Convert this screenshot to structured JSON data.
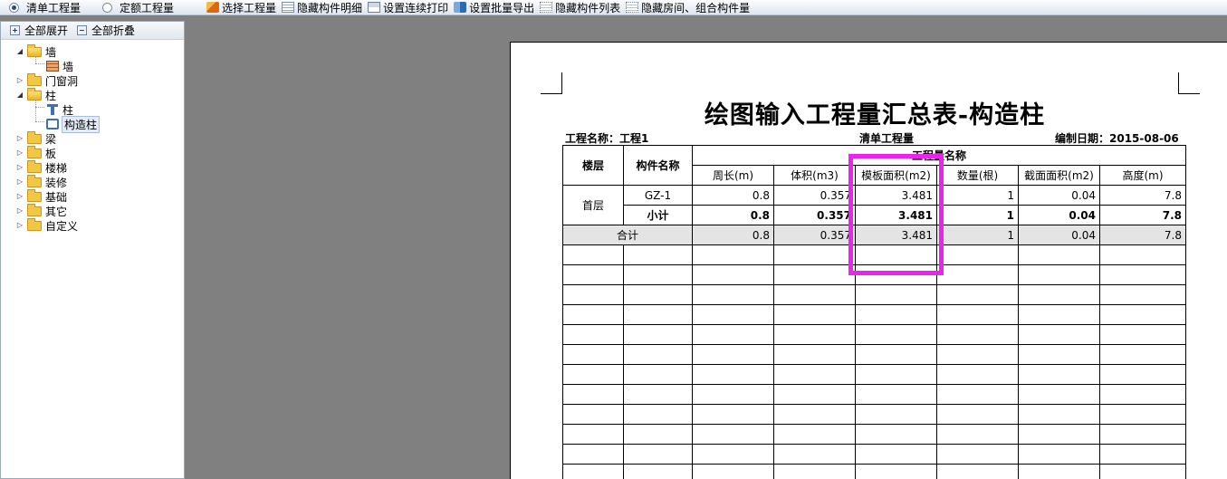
{
  "toolbar": {
    "radio_qingdan": "清单工程量",
    "radio_dinge": "定额工程量",
    "btn_select": "选择工程量",
    "btn_hide_detail": "隐藏构件明细",
    "btn_continuous_print": "设置连续打印",
    "btn_batch_export": "设置批量导出",
    "btn_hide_list": "隐藏构件列表",
    "btn_hide_room": "隐藏房间、组合构件量"
  },
  "left_panel": {
    "expand_all": "全部展开",
    "collapse_all": "全部折叠",
    "tree": {
      "wall": "墙",
      "wall_child": "墙",
      "door_window": "门窗洞",
      "column": "柱",
      "column_child": "柱",
      "gz_child": "构造柱",
      "beam": "梁",
      "slab": "板",
      "stair": "楼梯",
      "decoration": "装修",
      "foundation": "基础",
      "other": "其它",
      "custom": "自定义"
    }
  },
  "report": {
    "title": "绘图输入工程量汇总表-构造柱",
    "project_label": "工程名称：工程1",
    "qty_type": "清单工程量",
    "date_label": "编制日期：2015-08-06",
    "header_floor": "楼层",
    "header_component": "构件名称",
    "header_group": "工程量名称",
    "columns": [
      "周长(m)",
      "体积(m3)",
      "模板面积(m2)",
      "数量(根)",
      "截面面积(m2)",
      "高度(m)"
    ],
    "floor": "首层",
    "row_gz": {
      "name": "GZ-1",
      "values": [
        "0.8",
        "0.357",
        "3.481",
        "1",
        "0.04",
        "7.8"
      ]
    },
    "row_subtotal": {
      "name": "小计",
      "values": [
        "0.8",
        "0.357",
        "3.481",
        "1",
        "0.04",
        "7.8"
      ]
    },
    "row_total": {
      "name": "合计",
      "values": [
        "0.8",
        "0.357",
        "3.481",
        "1",
        "0.04",
        "7.8"
      ]
    }
  },
  "colors": {
    "highlight": "#ee22ee",
    "workspace_bg": "#808080"
  }
}
